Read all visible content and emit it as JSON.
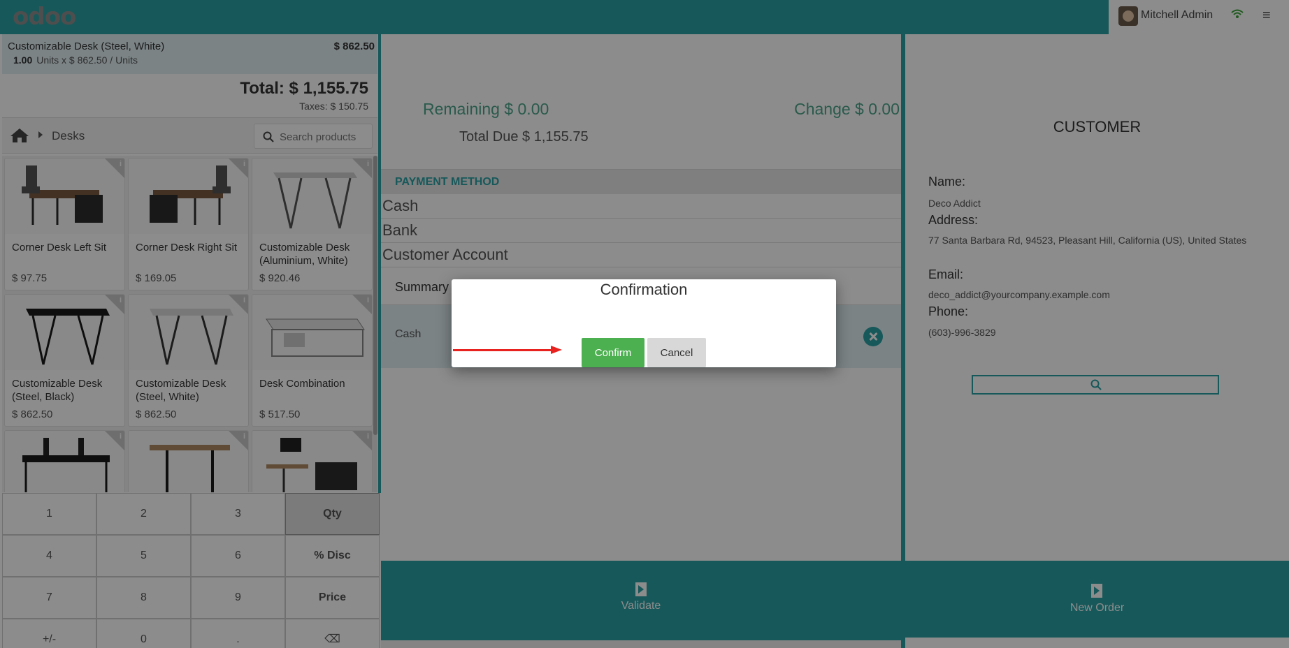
{
  "topbar": {
    "logo": "odoo",
    "user_name": "Mitchell Admin",
    "avatar_icon": "user-avatar",
    "wifi_icon": "wifi-icon",
    "menu_icon": "hamburger-menu-icon"
  },
  "order": {
    "line": {
      "name": "Customizable Desk (Steel, White)",
      "price": "$ 862.50",
      "qty": "1.00",
      "unit_info": "Units x $ 862.50 / Units"
    },
    "total": "Total: $ 1,155.75",
    "taxes": "Taxes: $ 150.75"
  },
  "breadcrumb": {
    "home_icon": "home-icon",
    "category": "Desks"
  },
  "search": {
    "placeholder": "Search products"
  },
  "products": [
    {
      "name": "Corner Desk Left Sit",
      "price": "$ 97.75"
    },
    {
      "name": "Corner Desk Right Sit",
      "price": "$ 169.05"
    },
    {
      "name": "Customizable Desk (Aluminium, White)",
      "price": "$ 920.46"
    },
    {
      "name": "Customizable Desk (Steel, Black)",
      "price": "$ 862.50"
    },
    {
      "name": "Customizable Desk (Steel, White)",
      "price": "$ 862.50"
    },
    {
      "name": "Desk Combination",
      "price": "$ 517.50"
    },
    {
      "name": "",
      "price": ""
    },
    {
      "name": "",
      "price": ""
    },
    {
      "name": "",
      "price": ""
    }
  ],
  "numpad": {
    "k1": "1",
    "k2": "2",
    "k3": "3",
    "qty": "Qty",
    "k4": "4",
    "k5": "5",
    "k6": "6",
    "disc": "% Disc",
    "k7": "7",
    "k8": "8",
    "k9": "9",
    "price": "Price",
    "sign": "+/-",
    "k0": "0",
    "dot": ".",
    "backspace": "⌫",
    "active_mode": "Qty"
  },
  "payment": {
    "remaining": "Remaining $ 0.00",
    "change": "Change $ 0.00",
    "total_due": "Total Due $ 1,155.75",
    "method_header": "PAYMENT METHOD",
    "methods": [
      "Cash",
      "Bank",
      "Customer Account"
    ],
    "summary_label": "Summary",
    "line_method": "Cash",
    "validate_label": "Validate"
  },
  "customer": {
    "title": "CUSTOMER",
    "name_label": "Name:",
    "name": "Deco Addict",
    "address_label": "Address:",
    "address": "77 Santa Barbara Rd, 94523, Pleasant Hill, California (US), United States",
    "email_label": "Email:",
    "email": "deco_addict@yourcompany.example.com",
    "phone_label": "Phone:",
    "phone": "(603)-996-3829",
    "new_order_label": "New Order"
  },
  "dialog": {
    "title": "Confirmation",
    "confirm_label": "Confirm",
    "cancel_label": "Cancel"
  },
  "colors": {
    "brand_teal": "#2aa1a5",
    "confirm_green": "#4caf50",
    "annotation_arrow": "#e8231f"
  }
}
